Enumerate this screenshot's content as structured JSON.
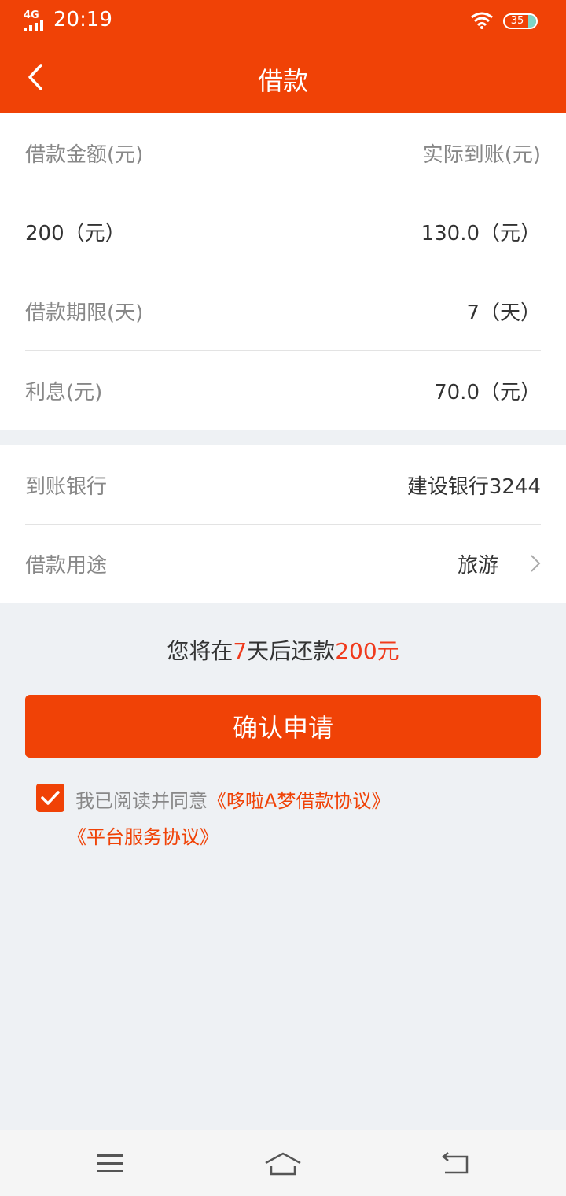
{
  "status": {
    "network": "4G",
    "time": "20:19",
    "battery": "35"
  },
  "header": {
    "title": "借款"
  },
  "loan": {
    "amount_label": "借款金额(元)",
    "received_label": "实际到账(元)",
    "amount_value": "200（元）",
    "received_value": "130.0（元）",
    "term_label": "借款期限(天)",
    "term_value": "7（天）",
    "interest_label": "利息(元)",
    "interest_value": "70.0（元）"
  },
  "bank": {
    "bank_label": "到账银行",
    "bank_value": "建设银行3244",
    "purpose_label": "借款用途",
    "purpose_value": "旅游"
  },
  "summary": {
    "prefix": "您将在",
    "days": "7",
    "mid": "天后还款",
    "amount": "200元"
  },
  "confirm_label": "确认申请",
  "agreement": {
    "text": "我已阅读并同意",
    "link1": "《哆啦A梦借款协议》",
    "link2": "《平台服务协议》"
  },
  "colors": {
    "brand": "#f04206",
    "highlight": "#f03a1c"
  },
  "icons": [
    "back-icon",
    "chevron-right-icon",
    "checkmark-icon",
    "menu-icon",
    "home-icon",
    "return-icon"
  ]
}
